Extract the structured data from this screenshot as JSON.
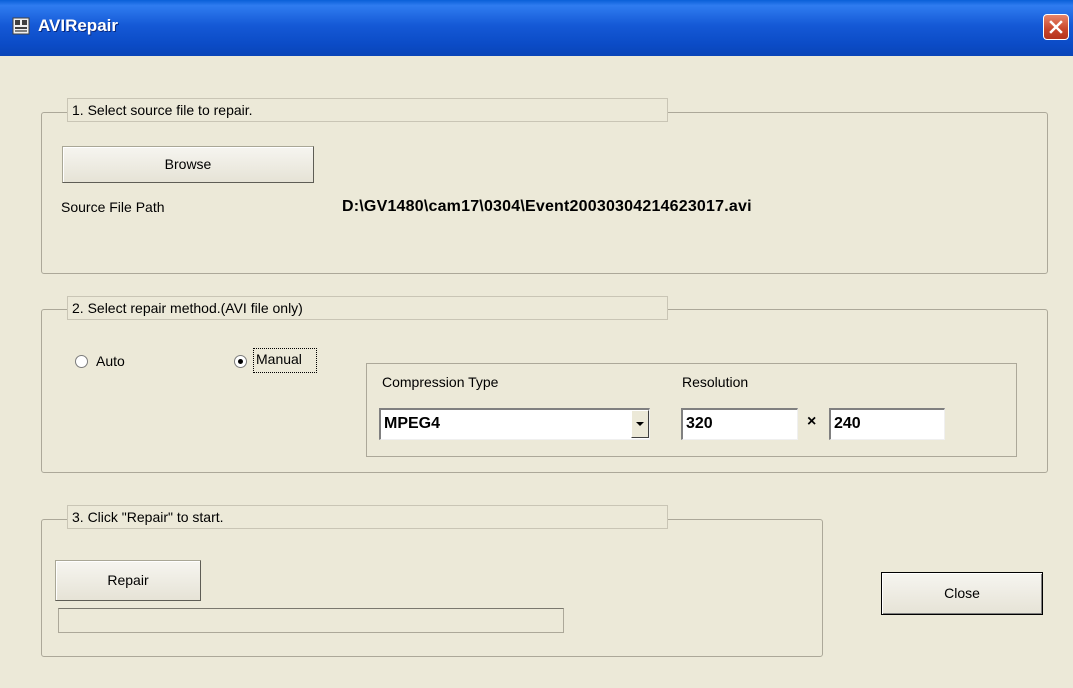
{
  "window": {
    "title": "AVIRepair",
    "app_icon": "app-icon",
    "close_icon": "close-icon"
  },
  "section1": {
    "legend": "1. Select source file to repair.",
    "browse_label": "Browse",
    "source_path_label": "Source File Path",
    "source_path_value": "D:\\GV1480\\cam17\\0304\\Event20030304214623017.avi"
  },
  "section2": {
    "legend": "2. Select repair method.(AVI file only)",
    "auto_label": "Auto",
    "manual_label": "Manual",
    "selected_method": "Manual",
    "compression_label": "Compression Type",
    "compression_value": "MPEG4",
    "resolution_label": "Resolution",
    "res_width": "320",
    "res_sep": "×",
    "res_height": "240"
  },
  "section3": {
    "legend": "3. Click \"Repair\" to start.",
    "repair_label": "Repair",
    "progress": 0
  },
  "close_label": "Close",
  "colors": {
    "titlebar": "#0b4bc6",
    "dialog_bg": "#ece9d8",
    "close_red": "#c8452a"
  }
}
